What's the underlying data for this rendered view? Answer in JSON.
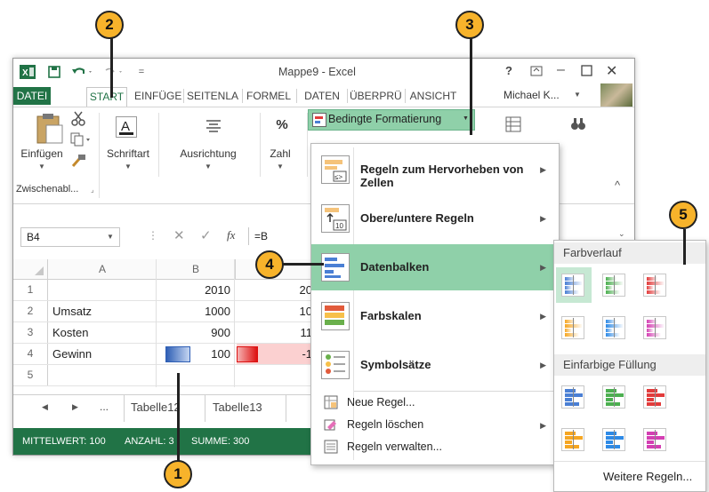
{
  "app": {
    "title": "Mappe9 - Excel",
    "help": "?",
    "user": "Michael K...",
    "colors": {
      "excel_green": "#217346",
      "accent_green": "#8fd0a9",
      "callout": "#f7b32b"
    }
  },
  "tabs": [
    "DATEI",
    "START",
    "EINFÜGE",
    "SEITENLA",
    "FORMEL",
    "DATEN",
    "ÜBERPRÜ",
    "ANSICHT"
  ],
  "ribbon": {
    "paste": "Einfügen",
    "clipboard_group": "Zwischenabl...",
    "font": "Schriftart",
    "alignment": "Ausrichtung",
    "number": "Zahl",
    "number_symbol": "%",
    "cond_format": "Bedingte Formatierung"
  },
  "formula_bar": {
    "name_box": "B4",
    "fx": "fx",
    "content": "=B"
  },
  "grid": {
    "col_a": "A",
    "col_b": "B",
    "rows": [
      {
        "n": "1",
        "a": "",
        "b": "2010",
        "c": "20"
      },
      {
        "n": "2",
        "a": "Umsatz",
        "b": "1000",
        "c": "10"
      },
      {
        "n": "3",
        "a": "Kosten",
        "b": "900",
        "c": "11"
      },
      {
        "n": "4",
        "a": "Gewinn",
        "b": "100",
        "c": "-1"
      },
      {
        "n": "5",
        "a": "",
        "b": "",
        "c": ""
      }
    ]
  },
  "sheets": {
    "ellipsis": "...",
    "tab1": "Tabelle12",
    "tab2": "Tabelle13"
  },
  "status": {
    "avg": "MITTELWERT: 100",
    "count": "ANZAHL: 3",
    "sum": "SUMME: 300"
  },
  "menu": {
    "highlight": "Regeln zum Hervorheben von Zellen",
    "topbottom": "Obere/untere Regeln",
    "databars": "Datenbalken",
    "colorscales": "Farbskalen",
    "iconsets": "Symbolsätze",
    "new_rule": "Neue Regel...",
    "clear_rules": "Regeln löschen",
    "manage_rules": "Regeln verwalten..."
  },
  "submenu": {
    "gradient": "Farbverlauf",
    "solid": "Einfarbige Füllung",
    "more": "Weitere Regeln...",
    "bar_colors": [
      "#4a7fd4",
      "#4caf50",
      "#e23b3b",
      "#f5a623",
      "#2e8ae6",
      "#d43fb3"
    ]
  },
  "callouts": [
    "1",
    "2",
    "3",
    "4",
    "5"
  ]
}
